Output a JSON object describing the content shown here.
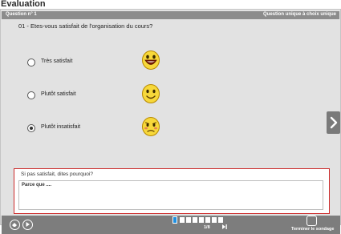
{
  "window": {
    "title": "Evaluation"
  },
  "question_header": {
    "number_label": "Question n° 1",
    "type_label": "Question unique à choix unique"
  },
  "question": {
    "text": "01 - Etes-vous satisfait de l'organisation du cours?"
  },
  "options": [
    {
      "label": "Très satisfait",
      "selected": false,
      "smiley_icon": "happy-smiley-icon"
    },
    {
      "label": "Plutôt satisfait",
      "selected": false,
      "smiley_icon": "smiling-smiley-icon"
    },
    {
      "label": "Plutôt insatisfait",
      "selected": true,
      "smiley_icon": "unhappy-smiley-icon"
    }
  ],
  "feedback": {
    "question": "Si pas satisfait, dites pourquoi?",
    "answer": "Parce que ...."
  },
  "pager": {
    "page_text": "1/8",
    "total_pages": 8,
    "current_page": 1
  },
  "footer": {
    "finish_label": "Terminer le sondage"
  },
  "colors": {
    "header_bar": "#8c8c8c",
    "bottom_bar": "#7d7d7d",
    "panel": "#e2e2e2",
    "feedback_border": "#cc2b2b",
    "current_page": "#1f8fe0",
    "smiley_fill": "#f7d83a"
  }
}
